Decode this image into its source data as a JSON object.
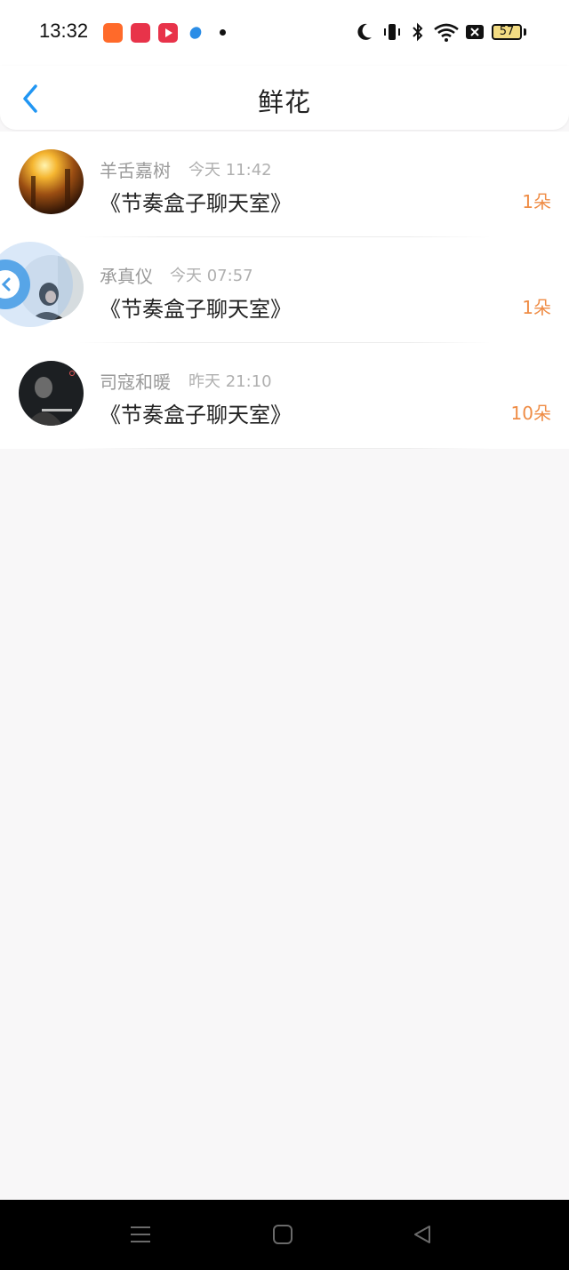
{
  "status_bar": {
    "time": "13:32",
    "battery": "57",
    "icons": [
      "moon-icon",
      "vibrate-icon",
      "bluetooth-icon",
      "wifi-icon",
      "sim-off-icon"
    ],
    "app_icons": [
      "taobao-app-icon",
      "heart-app-icon",
      "video-app-icon",
      "blue-app-icon"
    ]
  },
  "nav": {
    "title": "鲜花",
    "back_icon": "chevron-left-icon"
  },
  "rows": [
    {
      "name": "羊舌嘉树",
      "time": "今天 11:42",
      "room": "《节奏盒子聊天室》",
      "count": "1朵"
    },
    {
      "name": "承真仪",
      "time": "今天 07:57",
      "room": "《节奏盒子聊天室》",
      "count": "1朵"
    },
    {
      "name": "司寇和暖",
      "time": "昨天 21:10",
      "room": "《节奏盒子聊天室》",
      "count": "10朵"
    }
  ],
  "colors": {
    "accent": "#2196f3",
    "count": "#ef8c45",
    "background": "#f8f7f8"
  },
  "system_nav": [
    "menu-icon",
    "home-icon",
    "back-icon"
  ]
}
